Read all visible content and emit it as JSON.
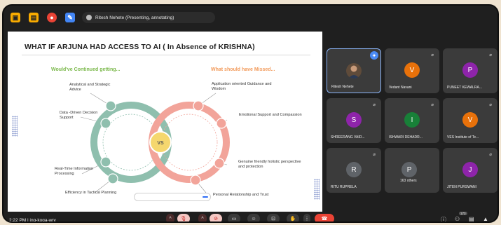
{
  "topbar": {
    "presenter_text": "Ritesh Nehete (Presenting, annotating)"
  },
  "slide": {
    "title": "WHAT IF ARJUNA HAD ACCESS TO AI ( In Absence of KRISHNA)",
    "left_heading": "Would've Continued getting...",
    "right_heading": "What should have Missed...",
    "center_label": "VS",
    "left_items": [
      "Analytical and Strategic Advice",
      "Data -Driven Decision Support",
      "Real-Time Information Processing",
      "Efficiency in Tactical Planning"
    ],
    "right_items": [
      "Application oriented Guidance and Wisdom",
      "Emotional Support and Compassion",
      "Genuine friendly holistic perspective and protection",
      "Personal Relationship and Trust"
    ],
    "colors": {
      "left": "#8fbfae",
      "right": "#f2a49a",
      "center": "#f5d76e"
    }
  },
  "participants": [
    {
      "name": "Ritesh Nehete",
      "initial": "",
      "color": "#5f4b3a",
      "photo": true
    },
    {
      "name": "Vedant Navani",
      "initial": "V",
      "color": "#e8710a"
    },
    {
      "name": "PUNEET KEWALRA...",
      "initial": "P",
      "color": "#8e24aa"
    },
    {
      "name": "SHREERANG VAID...",
      "initial": "S",
      "color": "#8e24aa"
    },
    {
      "name": "ISHWARI DEHADR...",
      "initial": "I",
      "color": "#188038"
    },
    {
      "name": "VES Institute of Te...",
      "initial": "V",
      "color": "#e8710a"
    },
    {
      "name": "RITU RUPRELA",
      "initial": "R",
      "color": "#5f6368"
    },
    {
      "name": "163 others",
      "initial": "P",
      "color": "#5f6368"
    },
    {
      "name": "JITEN PURSWANI",
      "initial": "J",
      "color": "#8e24aa"
    }
  ],
  "bottombar": {
    "meeting_info": "2:22 PM  |  jng-koga-wry",
    "participant_count": "173"
  }
}
